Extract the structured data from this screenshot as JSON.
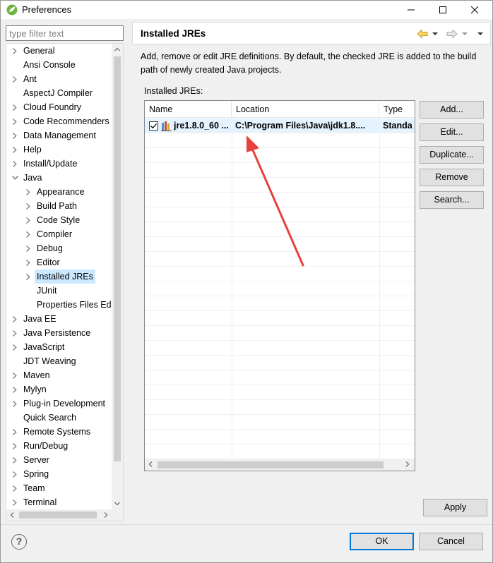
{
  "window": {
    "title": "Preferences",
    "minimize_icon": "minimize-icon",
    "maximize_icon": "maximize-icon",
    "close_icon": "close-icon"
  },
  "filter": {
    "placeholder": "type filter text",
    "value": ""
  },
  "tree": {
    "items": [
      {
        "label": "General",
        "expandable": true,
        "expanded": false,
        "level": 0
      },
      {
        "label": "Ansi Console",
        "expandable": false,
        "level": 0
      },
      {
        "label": "Ant",
        "expandable": true,
        "expanded": false,
        "level": 0
      },
      {
        "label": "AspectJ Compiler",
        "expandable": false,
        "level": 0
      },
      {
        "label": "Cloud Foundry",
        "expandable": true,
        "expanded": false,
        "level": 0
      },
      {
        "label": "Code Recommenders",
        "expandable": true,
        "expanded": false,
        "level": 0
      },
      {
        "label": "Data Management",
        "expandable": true,
        "expanded": false,
        "level": 0
      },
      {
        "label": "Help",
        "expandable": true,
        "expanded": false,
        "level": 0
      },
      {
        "label": "Install/Update",
        "expandable": true,
        "expanded": false,
        "level": 0
      },
      {
        "label": "Java",
        "expandable": true,
        "expanded": true,
        "level": 0
      },
      {
        "label": "Appearance",
        "expandable": true,
        "expanded": false,
        "level": 1
      },
      {
        "label": "Build Path",
        "expandable": true,
        "expanded": false,
        "level": 1
      },
      {
        "label": "Code Style",
        "expandable": true,
        "expanded": false,
        "level": 1
      },
      {
        "label": "Compiler",
        "expandable": true,
        "expanded": false,
        "level": 1
      },
      {
        "label": "Debug",
        "expandable": true,
        "expanded": false,
        "level": 1
      },
      {
        "label": "Editor",
        "expandable": true,
        "expanded": false,
        "level": 1
      },
      {
        "label": "Installed JREs",
        "expandable": true,
        "expanded": false,
        "level": 1,
        "selected": true
      },
      {
        "label": "JUnit",
        "expandable": false,
        "level": 1
      },
      {
        "label": "Properties Files Ed",
        "expandable": false,
        "level": 1
      },
      {
        "label": "Java EE",
        "expandable": true,
        "expanded": false,
        "level": 0
      },
      {
        "label": "Java Persistence",
        "expandable": true,
        "expanded": false,
        "level": 0
      },
      {
        "label": "JavaScript",
        "expandable": true,
        "expanded": false,
        "level": 0
      },
      {
        "label": "JDT Weaving",
        "expandable": false,
        "level": 0
      },
      {
        "label": "Maven",
        "expandable": true,
        "expanded": false,
        "level": 0
      },
      {
        "label": "Mylyn",
        "expandable": true,
        "expanded": false,
        "level": 0
      },
      {
        "label": "Plug-in Development",
        "expandable": true,
        "expanded": false,
        "level": 0
      },
      {
        "label": "Quick Search",
        "expandable": false,
        "level": 0
      },
      {
        "label": "Remote Systems",
        "expandable": true,
        "expanded": false,
        "level": 0
      },
      {
        "label": "Run/Debug",
        "expandable": true,
        "expanded": false,
        "level": 0
      },
      {
        "label": "Server",
        "expandable": true,
        "expanded": false,
        "level": 0
      },
      {
        "label": "Spring",
        "expandable": true,
        "expanded": false,
        "level": 0
      },
      {
        "label": "Team",
        "expandable": true,
        "expanded": false,
        "level": 0
      },
      {
        "label": "Terminal",
        "expandable": true,
        "expanded": false,
        "level": 0
      }
    ]
  },
  "page": {
    "title": "Installed JREs",
    "description": "Add, remove or edit JRE definitions. By default, the checked JRE is added to the build path of newly created Java projects.",
    "installed_label": "Installed JREs:",
    "table": {
      "columns": [
        "Name",
        "Location",
        "Type"
      ],
      "rows": [
        {
          "checked": true,
          "name": "jre1.8.0_60 ...",
          "location": "C:\\Program Files\\Java\\jdk1.8....",
          "type": "Standa"
        }
      ]
    },
    "buttons": {
      "add": "Add...",
      "edit": "Edit...",
      "duplicate": "Duplicate...",
      "remove": "Remove",
      "search": "Search..."
    },
    "apply": "Apply"
  },
  "footer": {
    "ok": "OK",
    "cancel": "Cancel",
    "help_glyph": "?"
  },
  "colors": {
    "selection": "#cce8ff",
    "default_button_border": "#0078d7",
    "annotation_arrow": "#e8413c"
  }
}
